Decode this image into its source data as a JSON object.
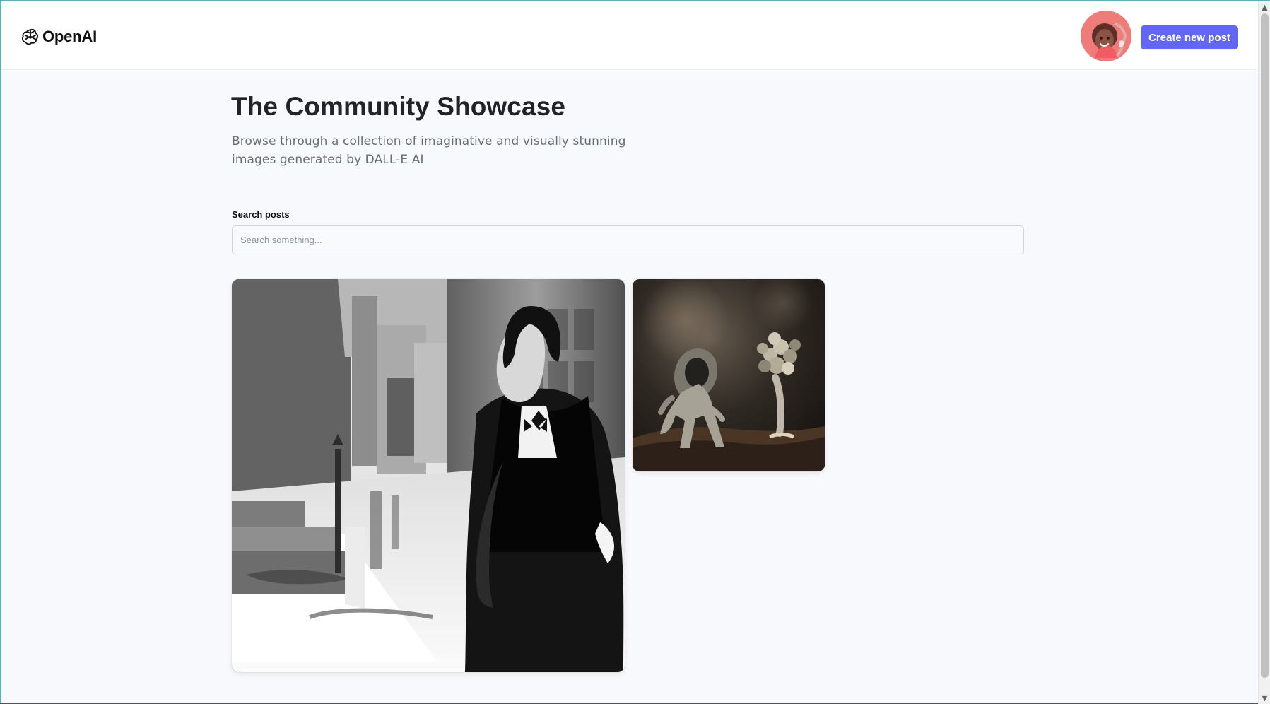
{
  "header": {
    "brand": "OpenAI",
    "create_button_label": "Create new post",
    "brand_icon": "openai-logo-icon",
    "avatar_icon": "user-avatar"
  },
  "main": {
    "title": "The Community Showcase",
    "subtitle": "Browse through a collection of imaginative and visually stunning images generated by DALL-E AI",
    "search": {
      "label": "Search posts",
      "placeholder": "Search something..."
    },
    "cards": [
      {
        "name": "post-card-1"
      },
      {
        "name": "post-card-2"
      }
    ]
  },
  "colors": {
    "primary": "#6366f1",
    "background": "#f8f9fd",
    "text": "#222328",
    "muted": "#666e75"
  }
}
